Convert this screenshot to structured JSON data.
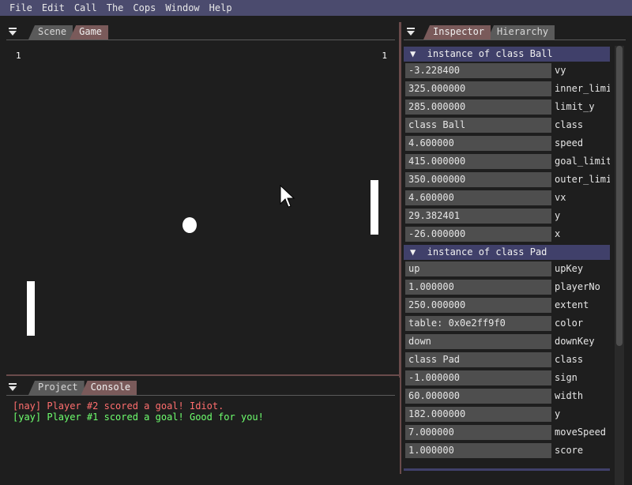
{
  "menu": [
    "File",
    "Edit",
    "Call",
    "The",
    "Cops",
    "Window",
    "Help"
  ],
  "game_panel": {
    "tabs": [
      "Scene",
      "Game"
    ],
    "active_tab": "Game",
    "score_left": "1",
    "score_right": "1"
  },
  "console_panel": {
    "tabs": [
      "Project",
      "Console"
    ],
    "active_tab": "Console",
    "lines": [
      {
        "text": "[nay] Player #2 scored a goal! Idiot.",
        "color": "#ff6e6e"
      },
      {
        "text": "[yay] Player #1 scored a goal! Good for you!",
        "color": "#6eff6e"
      }
    ]
  },
  "inspector_panel": {
    "tabs": [
      "Inspector",
      "Hierarchy"
    ],
    "active_tab": "Inspector",
    "sections": [
      {
        "title": "▼  instance of class Ball",
        "props": [
          {
            "value": "-3.228400",
            "name": "vy"
          },
          {
            "value": "325.000000",
            "name": "inner_limit"
          },
          {
            "value": "285.000000",
            "name": "limit_y"
          },
          {
            "value": "class Ball",
            "name": "class"
          },
          {
            "value": "4.600000",
            "name": "speed"
          },
          {
            "value": "415.000000",
            "name": "goal_limit"
          },
          {
            "value": "350.000000",
            "name": "outer_limit"
          },
          {
            "value": "4.600000",
            "name": "vx"
          },
          {
            "value": "29.382401",
            "name": "y"
          },
          {
            "value": "-26.000000",
            "name": "x"
          }
        ]
      },
      {
        "title": "▼  instance of class Pad",
        "props": [
          {
            "value": "up",
            "name": "upKey"
          },
          {
            "value": "1.000000",
            "name": "playerNo"
          },
          {
            "value": "250.000000",
            "name": "extent"
          },
          {
            "value": "table: 0x0e2ff9f0",
            "name": "color"
          },
          {
            "value": "down",
            "name": "downKey"
          },
          {
            "value": "class Pad",
            "name": "class"
          },
          {
            "value": "-1.000000",
            "name": "sign"
          },
          {
            "value": "60.000000",
            "name": "width"
          },
          {
            "value": "182.000000",
            "name": "y"
          },
          {
            "value": "7.000000",
            "name": "moveSpeed"
          },
          {
            "value": "1.000000",
            "name": "score"
          }
        ]
      }
    ]
  },
  "colors": {
    "menubar": "#4b4b6e",
    "section_header": "#40406a",
    "active_tab": "#7a5a5a",
    "inactive_tab": "#5a5a5a",
    "field_bg": "#4e4e4e",
    "window_bg": "#1e1e1e",
    "splitter": "#6a4b4b"
  },
  "icons": {
    "collapse": "menu-collapse-icon",
    "cursor": "mouse-pointer-icon"
  }
}
